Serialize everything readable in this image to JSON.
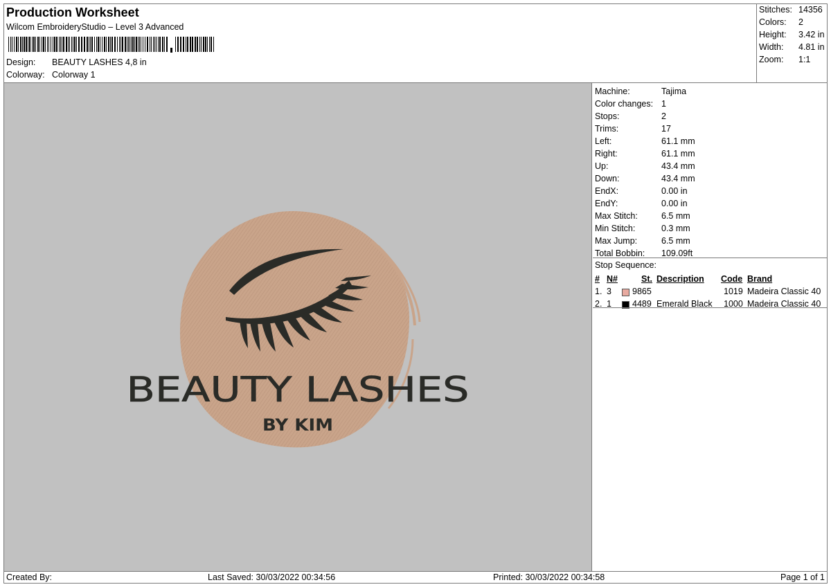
{
  "header": {
    "title": "Production Worksheet",
    "subtitle": "Wilcom EmbroideryStudio – Level 3 Advanced",
    "design_label": "Design:",
    "design_value": "BEAUTY LASHES 4,8 in",
    "colorway_label": "Colorway:",
    "colorway_value": "Colorway 1"
  },
  "summary": [
    {
      "label": "Stitches:",
      "value": "14356"
    },
    {
      "label": "Colors:",
      "value": "2"
    },
    {
      "label": "Height:",
      "value": "3.42 in"
    },
    {
      "label": "Width:",
      "value": "4.81 in"
    },
    {
      "label": "Zoom:",
      "value": "1:1"
    }
  ],
  "design": {
    "title_text": "BEAUTY LASHES",
    "sub_text": "BY KIM",
    "colors": {
      "background": "#c1c1c1",
      "fill": "#c9a48a",
      "thread": "#2a2b27"
    }
  },
  "properties": [
    {
      "label": "Machine:",
      "value": "Tajima"
    },
    {
      "label": "Color changes:",
      "value": "1"
    },
    {
      "label": "Stops:",
      "value": "2"
    },
    {
      "label": "Trims:",
      "value": "17"
    },
    {
      "label": "Left:",
      "value": "61.1 mm"
    },
    {
      "label": "Right:",
      "value": "61.1 mm"
    },
    {
      "label": "Up:",
      "value": "43.4 mm"
    },
    {
      "label": "Down:",
      "value": "43.4 mm"
    },
    {
      "label": "EndX:",
      "value": "0.00 in"
    },
    {
      "label": "EndY:",
      "value": "0.00 in"
    },
    {
      "label": "Max Stitch:",
      "value": "6.5 mm"
    },
    {
      "label": "Min Stitch:",
      "value": "0.3 mm"
    },
    {
      "label": "Max Jump:",
      "value": "6.5 mm"
    },
    {
      "label": "Total Bobbin:",
      "value": "109.09ft"
    }
  ],
  "stop_sequence": {
    "title": "Stop Sequence:",
    "headers": {
      "num": "#",
      "needle": "N#",
      "st": "St.",
      "description": "Description",
      "code": "Code",
      "brand": "Brand"
    },
    "rows": [
      {
        "num": "1.",
        "needle": "3",
        "color": "#e8aaa0",
        "st": "9865",
        "description": "",
        "code": "1019",
        "brand": "Madeira Classic 40"
      },
      {
        "num": "2.",
        "needle": "1",
        "color": "#000000",
        "st": "4489",
        "description": "Emerald Black",
        "code": "1000",
        "brand": "Madeira Classic 40"
      }
    ]
  },
  "footer": {
    "created_by": "Created By:",
    "last_saved": "Last Saved: 30/03/2022 00:34:56",
    "printed": "Printed: 30/03/2022 00:34:58",
    "page": "Page 1 of 1"
  }
}
